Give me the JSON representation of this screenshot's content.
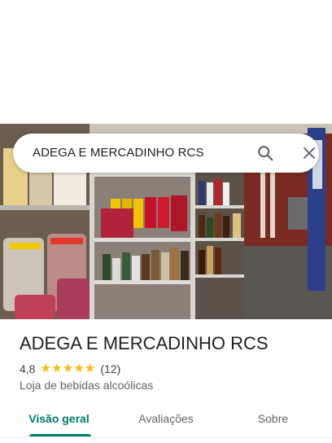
{
  "search": {
    "query": "ADEGA E MERCADINHO RCS",
    "search_icon": "search-icon",
    "close_icon": "close-icon"
  },
  "place": {
    "photo": "storefront-photo",
    "name": "ADEGA E MERCADINHO RCS",
    "rating": "4,8",
    "stars": 5,
    "review_count": "(12)",
    "category": "Loja de bebidas alcoólicas"
  },
  "tabs": [
    {
      "label": "Visão geral",
      "active": true
    },
    {
      "label": "Avaliações",
      "active": false
    },
    {
      "label": "Sobre",
      "active": false
    }
  ],
  "colors": {
    "accent": "#00796b",
    "star": "#fbbc04"
  }
}
